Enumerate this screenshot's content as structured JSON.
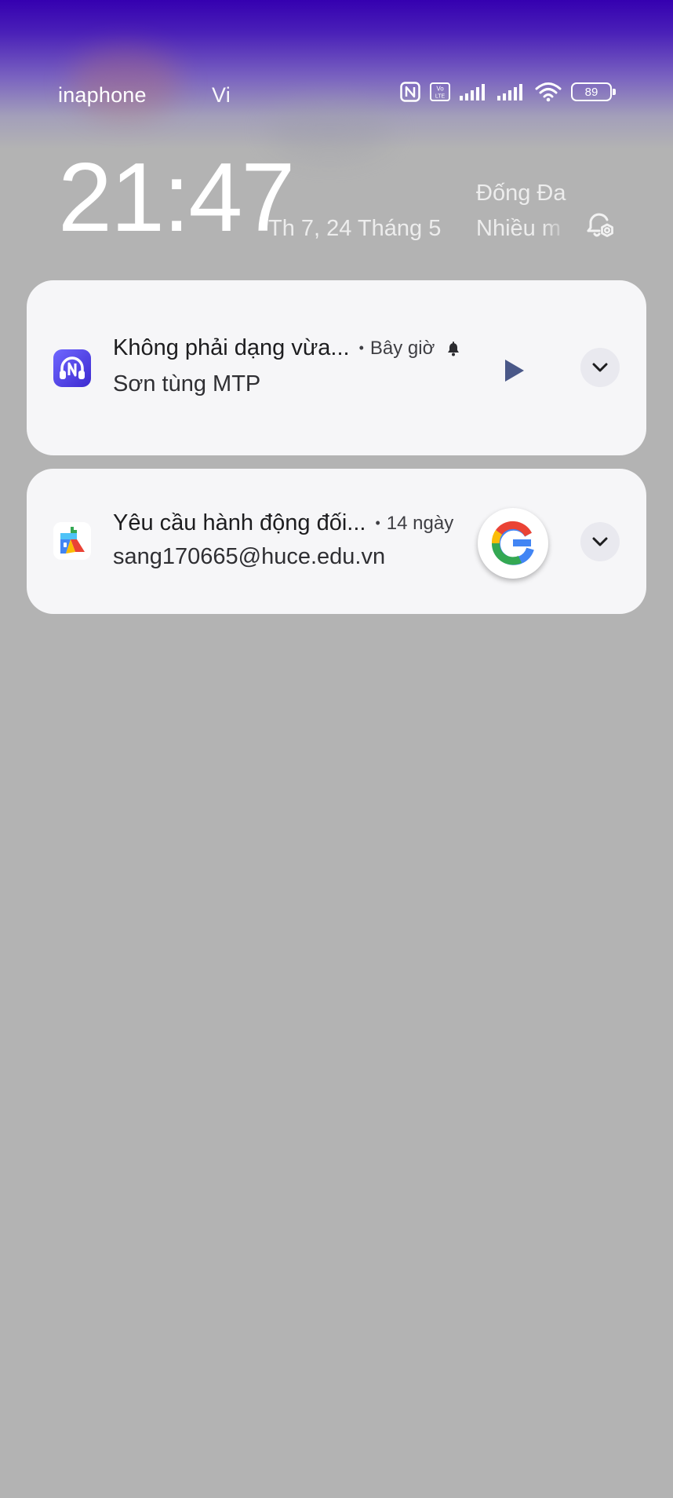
{
  "status_bar": {
    "carrier_1": "inaphone",
    "carrier_2": "Vi",
    "battery_level": "89",
    "icons": [
      "nfc-icon",
      "volte-icon",
      "signal-icon",
      "signal-icon",
      "wifi-icon",
      "battery-icon"
    ]
  },
  "lock_screen": {
    "time": "21:47",
    "date": "Th 7, 24 Tháng 5",
    "weather_location": "Đống Đa",
    "weather_desc": "Nhiều m"
  },
  "notifications": [
    {
      "app_icon": "music-app-icon",
      "title": "Không phải dạng vừa...",
      "time": "Bây giờ",
      "subtitle": "Sơn tùng MTP",
      "action_icon": "play-icon"
    },
    {
      "app_icon": "google-play-services-icon",
      "title": "Yêu cầu hành động đối...",
      "time": "14 ngày",
      "subtitle": "sang170665@huce.edu.vn",
      "thumbnail_icon": "google-logo-icon"
    }
  ],
  "colors": {
    "background": "#b3b3b3",
    "top_gradient": "#3500b0",
    "card_bg": "#f6f6f8",
    "play_accent": "#4a5888"
  }
}
